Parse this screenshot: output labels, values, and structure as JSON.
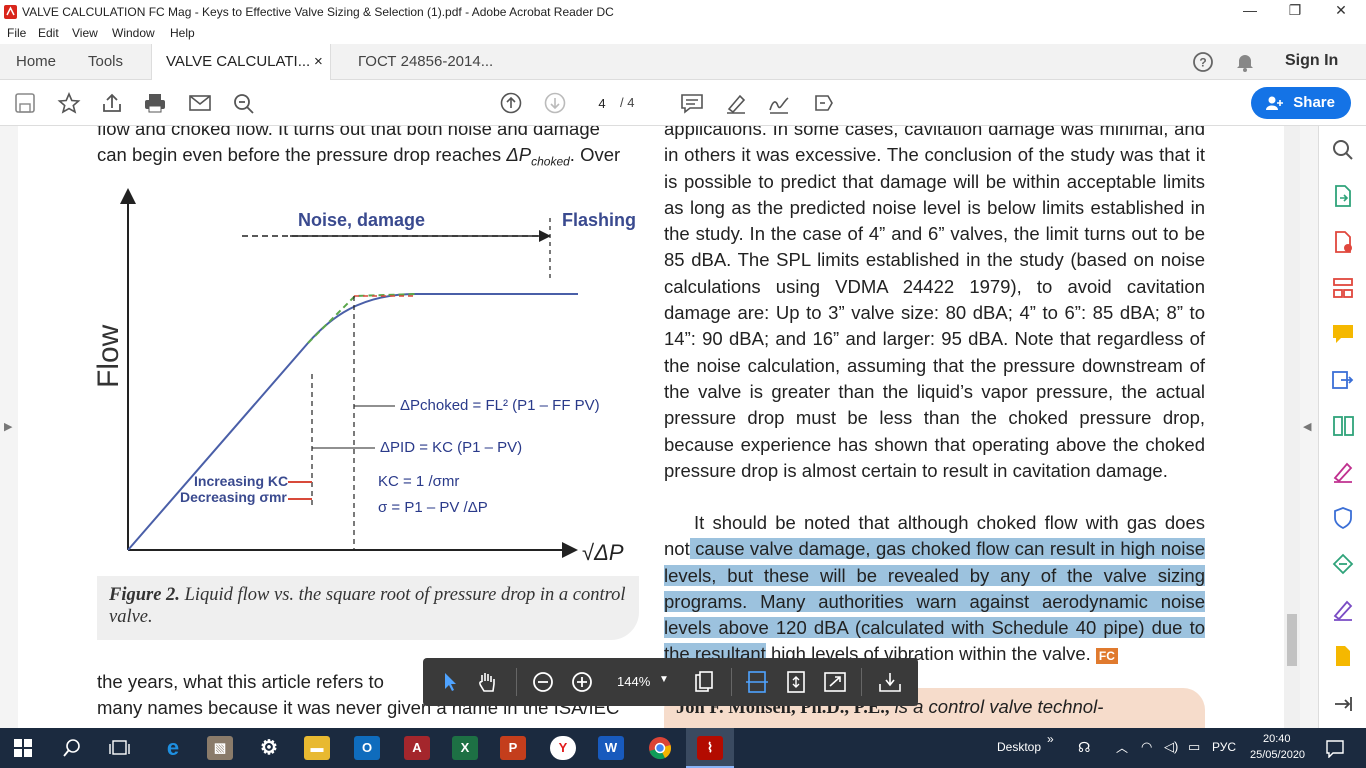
{
  "window": {
    "title": "VALVE CALCULATION FC Mag - Keys to Effective Valve Sizing & Selection (1).pdf - Adobe Acrobat Reader DC",
    "minimize": "—",
    "restore": "❐",
    "close": "✕"
  },
  "menu": [
    "File",
    "Edit",
    "View",
    "Window",
    "Help"
  ],
  "tabs": {
    "home": "Home",
    "tools": "Tools",
    "doc1": "VALVE CALCULATI...",
    "doc1_close": "×",
    "doc2": "ГОСТ 24856-2014...",
    "sign_in": "Sign In"
  },
  "toolbar": {
    "page_current": "4",
    "page_total": "/ 4",
    "share": "Share"
  },
  "document": {
    "left_top_line1": "flow and choked flow. It turns out that both noise and damage",
    "left_top_line2a": "can begin even before the pressure drop reaches ",
    "left_top_line2_symbol": "ΔP",
    "left_top_line2_sub": "choked",
    "left_top_line2b": ". Over",
    "figure": {
      "label_noise": "Noise, damage",
      "label_flashing": "Flashing",
      "label_flow": "Flow",
      "label_x": "√ΔP",
      "eq_choked": "ΔPchoked = FL² (P1 – FF PV)",
      "eq_id": "ΔPID = KC (P1 – PV)",
      "eq_kc": "KC = 1 /σmr",
      "eq_sigma": "σ = P1 – PV /ΔP",
      "increasing": "Increasing KC",
      "decreasing": "Decreasing σmr"
    },
    "caption_bold": "Figure 2.",
    "caption_text": " Liquid flow vs. the square root of pressure drop in a control valve.",
    "left_bottom_line1": "the years, what this article refers to",
    "left_bottom_line2": "many names because it was never given a name in the ISA/IEC",
    "right_para1": "applications. In some cases, cavitation damage was minimal, and in others it was excessive. The conclusion of the study was that it is possible to predict that damage will be within acceptable limits as long as the predicted noise level is below limits established in the study. In the case of 4” and 6” valves, the limit turns out to be 85 dBA. The SPL limits established in the study (based on noise calculations using VDMA 24422 1979), to avoid cavitation damage are: Up to 3” valve size: 80 dBA; 4” to 6”: 85 dBA; 8” to 14”: 90 dBA; and 16” and larger: 95 dBA. Note that regardless of the noise calculation, assuming that the pressure downstream of the valve is greater than the liquid’s vapor pressure, the actual pressure drop must be less than the choked pressure drop, because experience has shown that operating above the choked pressure drop is almost certain to result in cavitation damage.",
    "right_para2_start": "It should be noted that although choked flow with gas does not",
    "right_para2_highlight": " cause valve damage, gas choked flow can result in high noise levels, but these will be revealed by any of the valve sizing programs. Many authorities warn against aerodynamic noise levels above 120 dBA (calculated with Schedule 40 pipe) due to the resultant",
    "right_para2_end": " high levels of vibration within the valve.",
    "fc_badge": "FC",
    "bio_name": "Jon F. Monsen, Ph.D., P.E.,",
    "bio_text": " is a control valve technol-"
  },
  "float_toolbar": {
    "zoom": "144%"
  },
  "taskbar": {
    "desktop": "Desktop",
    "lang": "РУС",
    "time": "20:40",
    "date": "25/05/2020"
  }
}
